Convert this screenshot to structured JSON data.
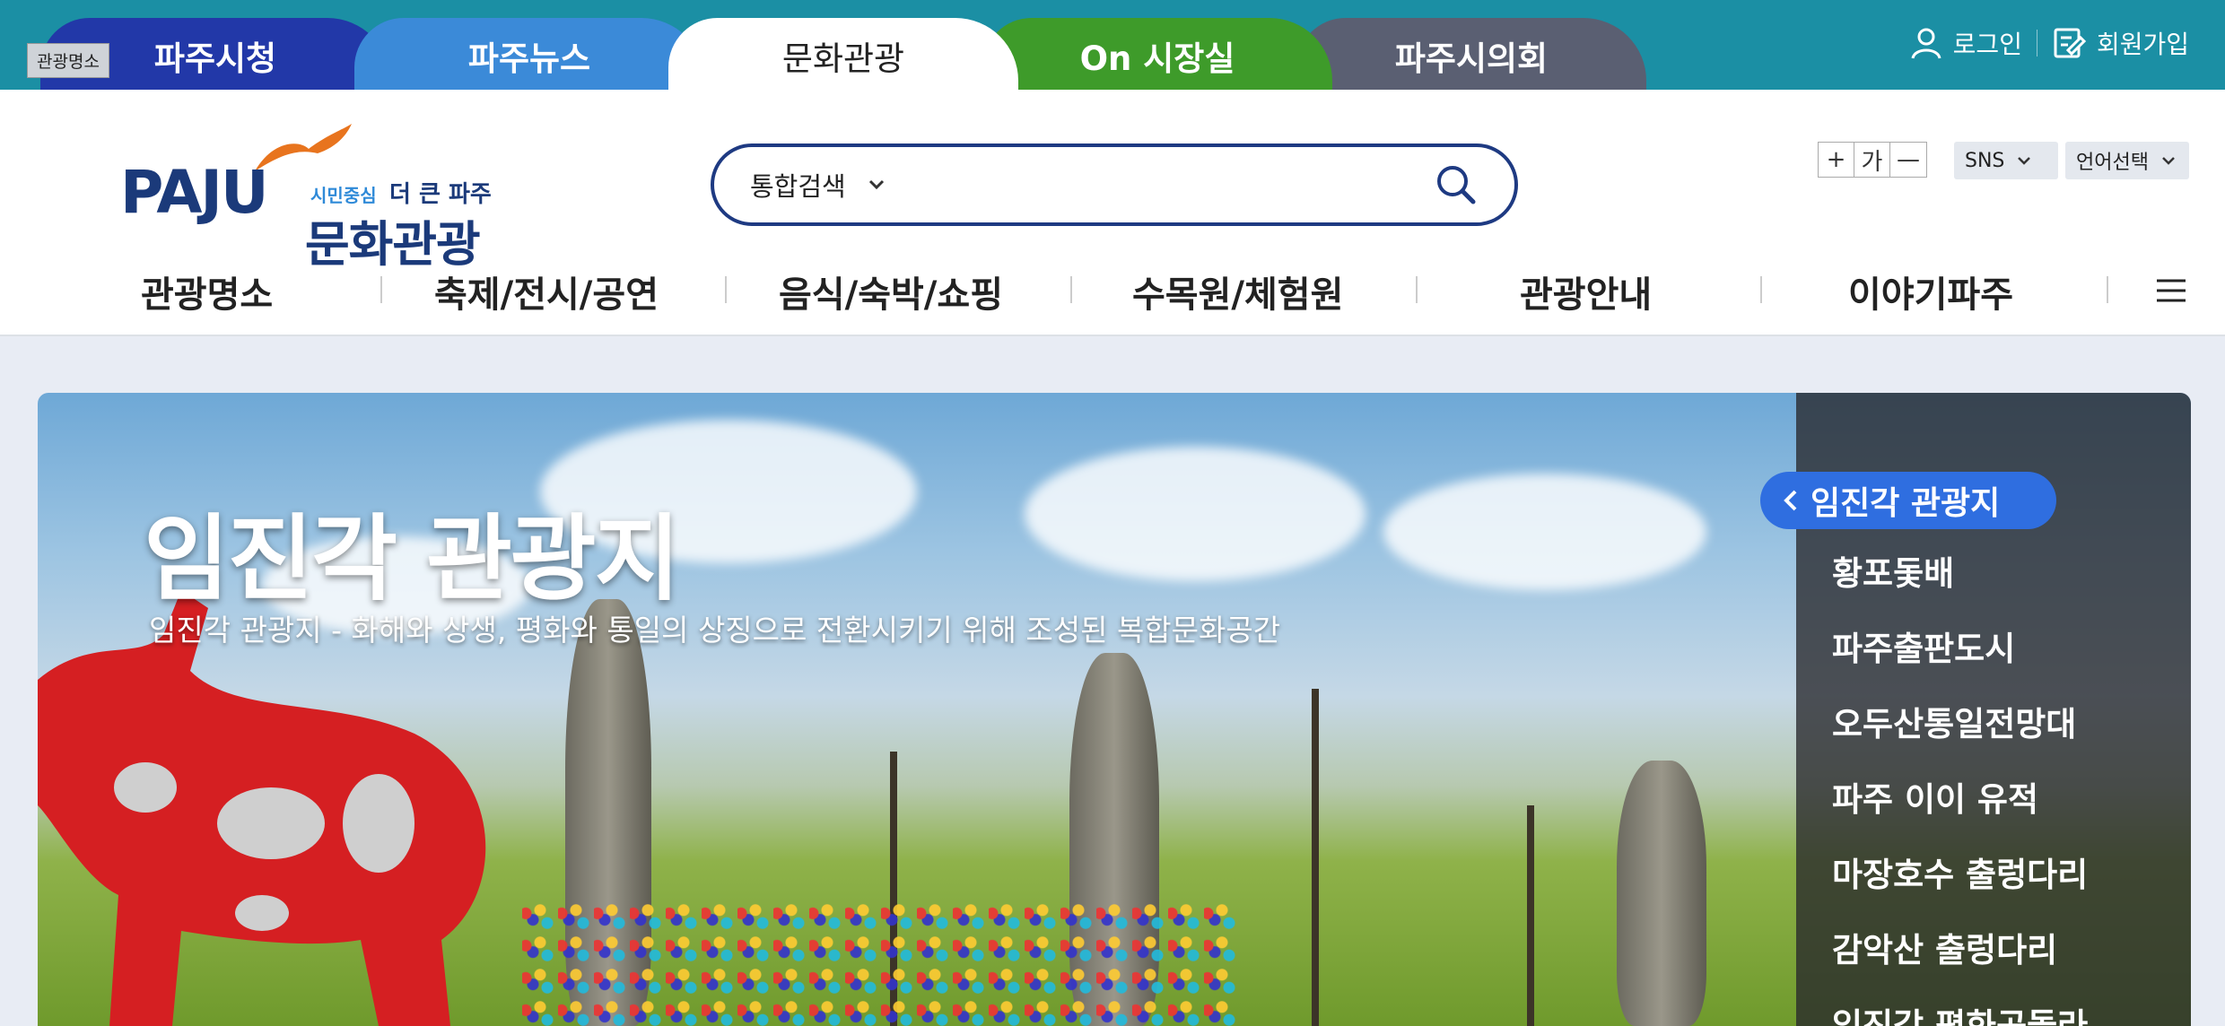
{
  "topbar": {
    "skip_badge": "관광명소",
    "sites": [
      "파주시청",
      "파주뉴스",
      "문화관광",
      "On 시장실",
      "파주시의회"
    ],
    "login": "로그인",
    "signup": "회원가입"
  },
  "header": {
    "logo": {
      "paju": "PAJU",
      "slogan_a": "시민중심",
      "slogan_b": "더 큰 파주",
      "name": "문화관광"
    },
    "search": {
      "select": "통합검색",
      "placeholder": ""
    },
    "font_controls": {
      "plus": "+",
      "ga": "가",
      "minus": "—"
    },
    "sns": "SNS",
    "language": "언어선택"
  },
  "gnb": [
    "관광명소",
    "축제/전시/공연",
    "음식/숙박/쇼핑",
    "수목원/체험원",
    "관광안내",
    "이야기파주"
  ],
  "hero": {
    "title": "임진각 관광지",
    "subtitle": "임진각 관광지 - 화해와 상생, 평화와 통일의 상징으로 전환시키기 위해 조성된 복합문화공간",
    "active_item": "임진각 관광지",
    "side_items": [
      "황포돛배",
      "파주출판도시",
      "오두산통일전망대",
      "파주 이이 유적",
      "마장호수 출렁다리",
      "감악산 출렁다리",
      "임진각 평화곤돌라"
    ]
  },
  "colors": {
    "topbar": "#1b8fa4",
    "primary": "#1e3a82",
    "active": "#2f6ee0"
  },
  "icons": [
    "user-icon",
    "signup-icon",
    "search-icon",
    "chevron-down-icon",
    "menu-icon",
    "chevron-left-icon"
  ]
}
